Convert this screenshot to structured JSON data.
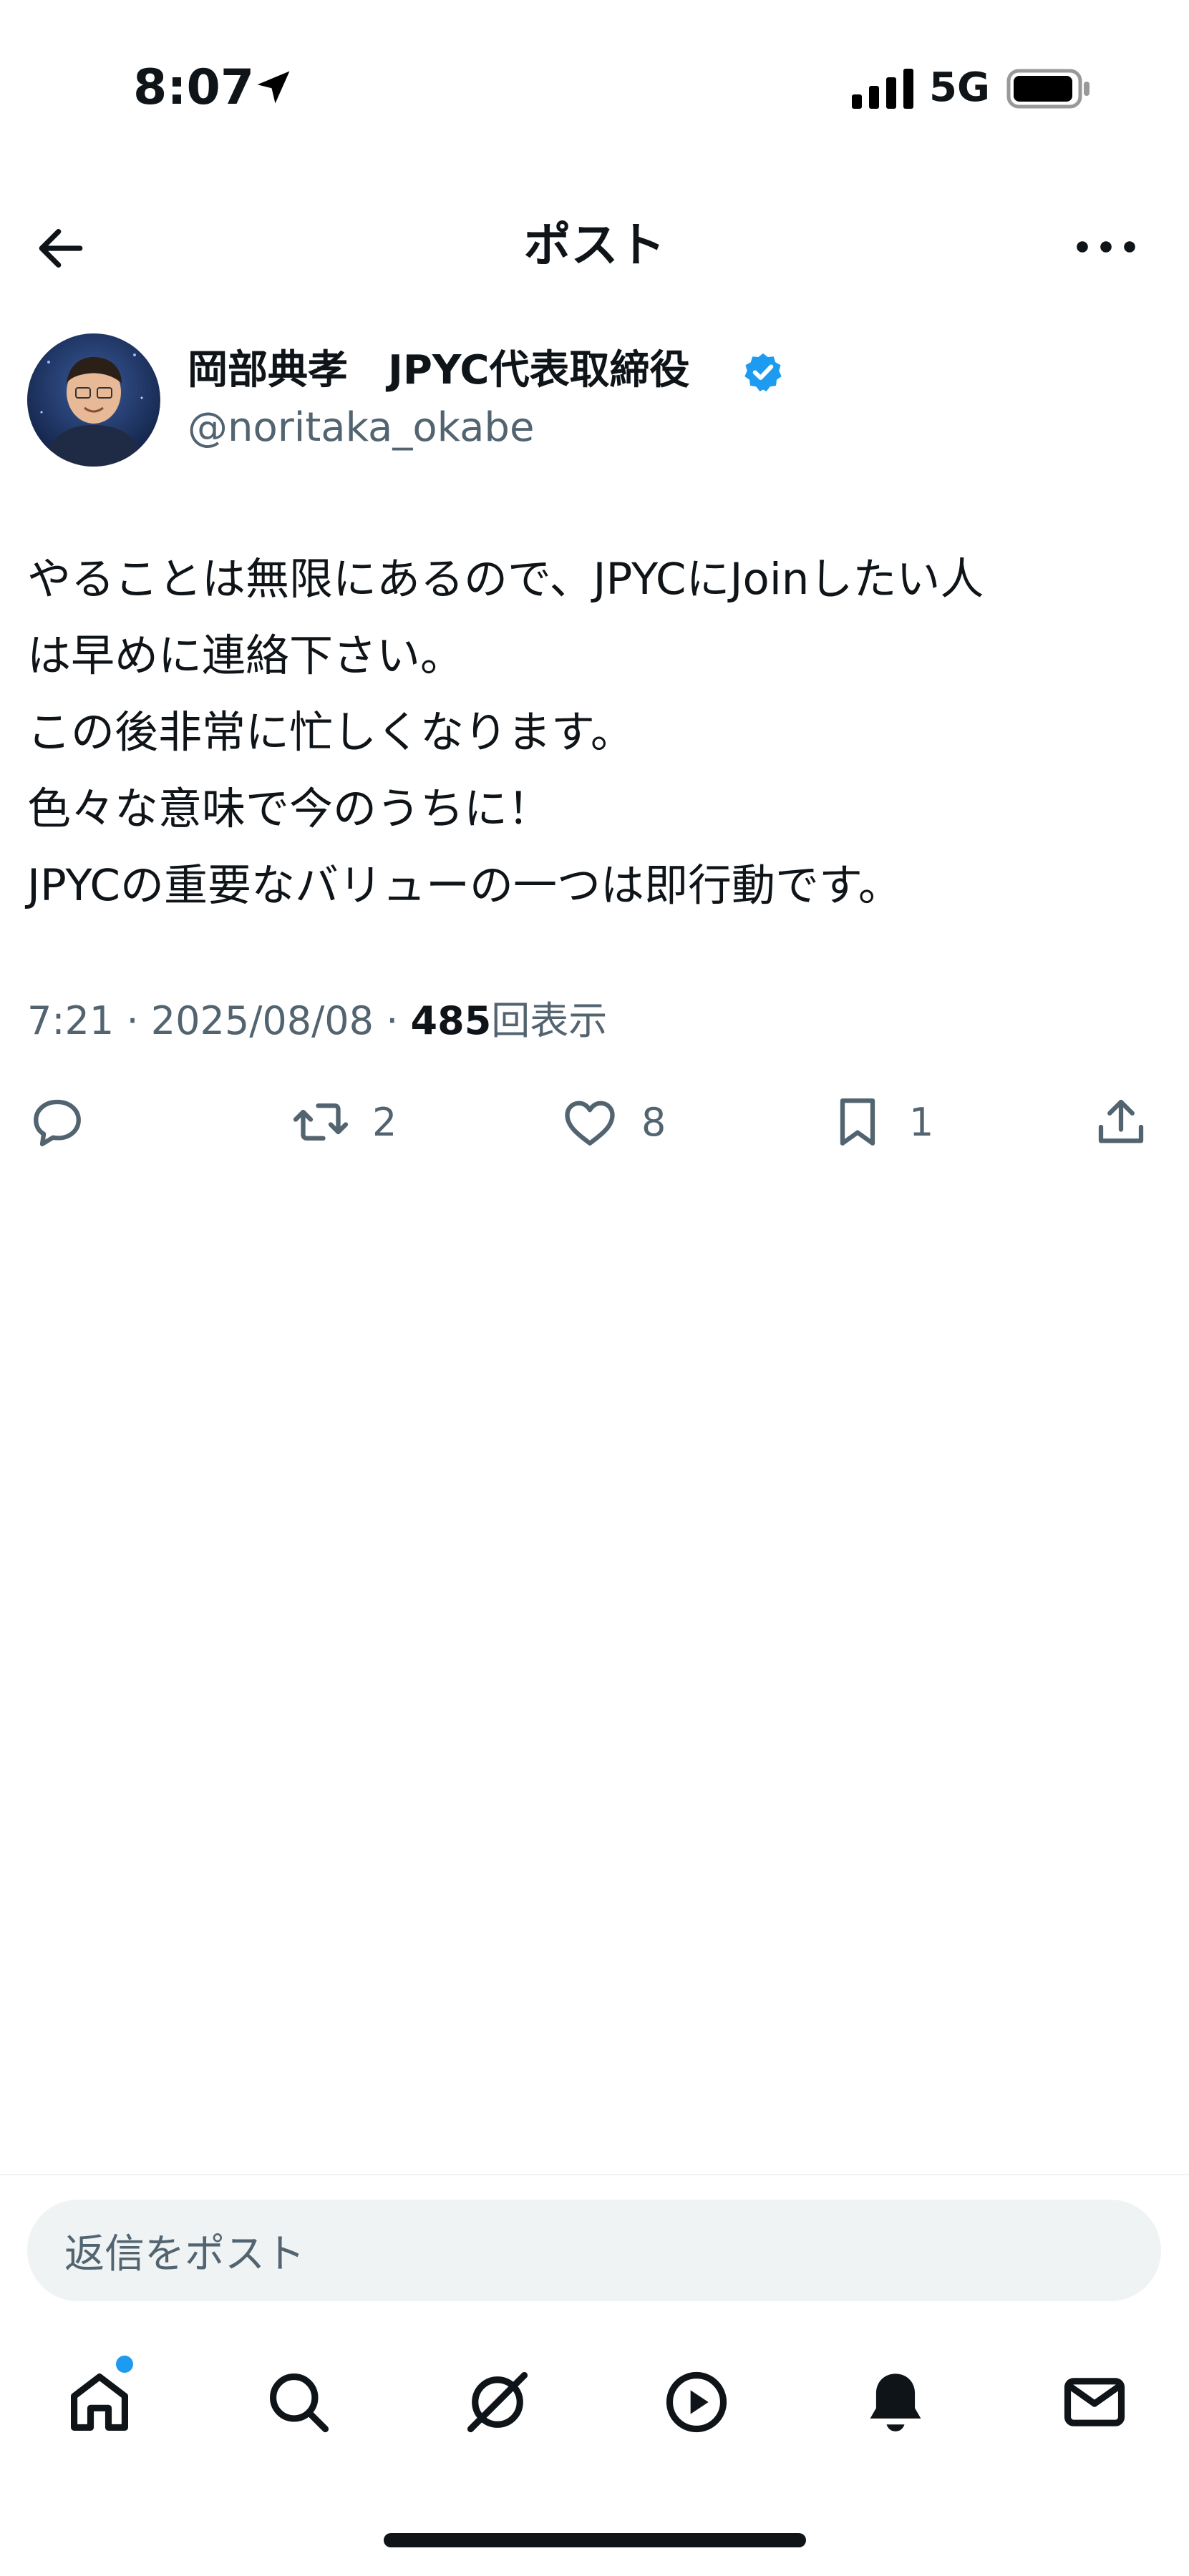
{
  "status_bar": {
    "time": "8:07",
    "network": "5G",
    "battery_level_percent": 85
  },
  "header": {
    "title": "ポスト"
  },
  "author": {
    "display_name": "岡部典孝　JPYC代表取締役",
    "handle": "@noritaka_okabe",
    "verified": true
  },
  "post": {
    "lines": [
      "やることは無限にあるので、JPYCにJoinしたい人",
      "は早めに連絡下さい。",
      "この後非常に忙しくなります。",
      "色々な意味で今のうちに！",
      "JPYCの重要なバリューの一つは即行動です。"
    ],
    "time": "7:21",
    "date": "2025/08/08",
    "separator": "·",
    "views_count": "485",
    "views_label": "回表示"
  },
  "actions": {
    "reply_count": "",
    "repost_count": "2",
    "like_count": "8",
    "bookmark_count": "1"
  },
  "reply_box": {
    "placeholder": "返信をポスト"
  },
  "tab_bar": {
    "items": [
      "home-icon",
      "search-icon",
      "grok-icon",
      "video-icon",
      "notifications-icon",
      "messages-icon"
    ],
    "active": "home-icon",
    "accent_color": "#1d9bf0"
  },
  "colors": {
    "text": "#0f1419",
    "secondary": "#536471",
    "accent": "#1d9bf0",
    "surface": "#eff3f4"
  }
}
